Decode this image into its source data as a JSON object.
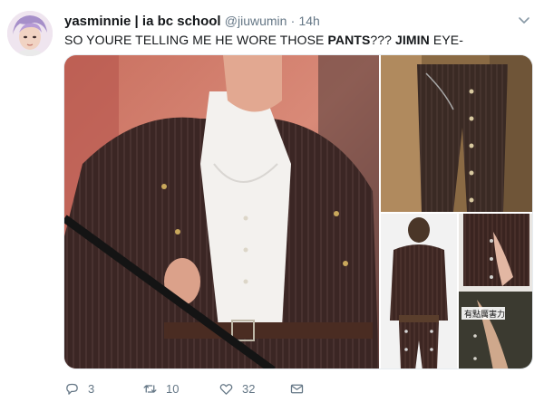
{
  "tweet": {
    "display_name": "yasminnie | ia bc school",
    "handle": "@jiuwumin",
    "separator": "·",
    "time": "14h",
    "text_parts": {
      "p1": "SO YOURE TELLING ME HE WORE THOSE ",
      "p2": "PANTS",
      "p3": "??? ",
      "p4": "JIMIN",
      "p5": " EYE-"
    },
    "media_caption": "有點厲害力"
  },
  "actions": {
    "reply_count": "3",
    "retweet_count": "10",
    "like_count": "32"
  },
  "icons": {
    "avatar": "avatar-photo",
    "caret": "chevron-down-icon",
    "reply": "reply-icon",
    "retweet": "retweet-icon",
    "like": "heart-icon",
    "dm": "envelope-icon"
  },
  "colors": {
    "text_primary": "#14171a",
    "text_secondary": "#657786",
    "border": "#e6ecf0"
  }
}
